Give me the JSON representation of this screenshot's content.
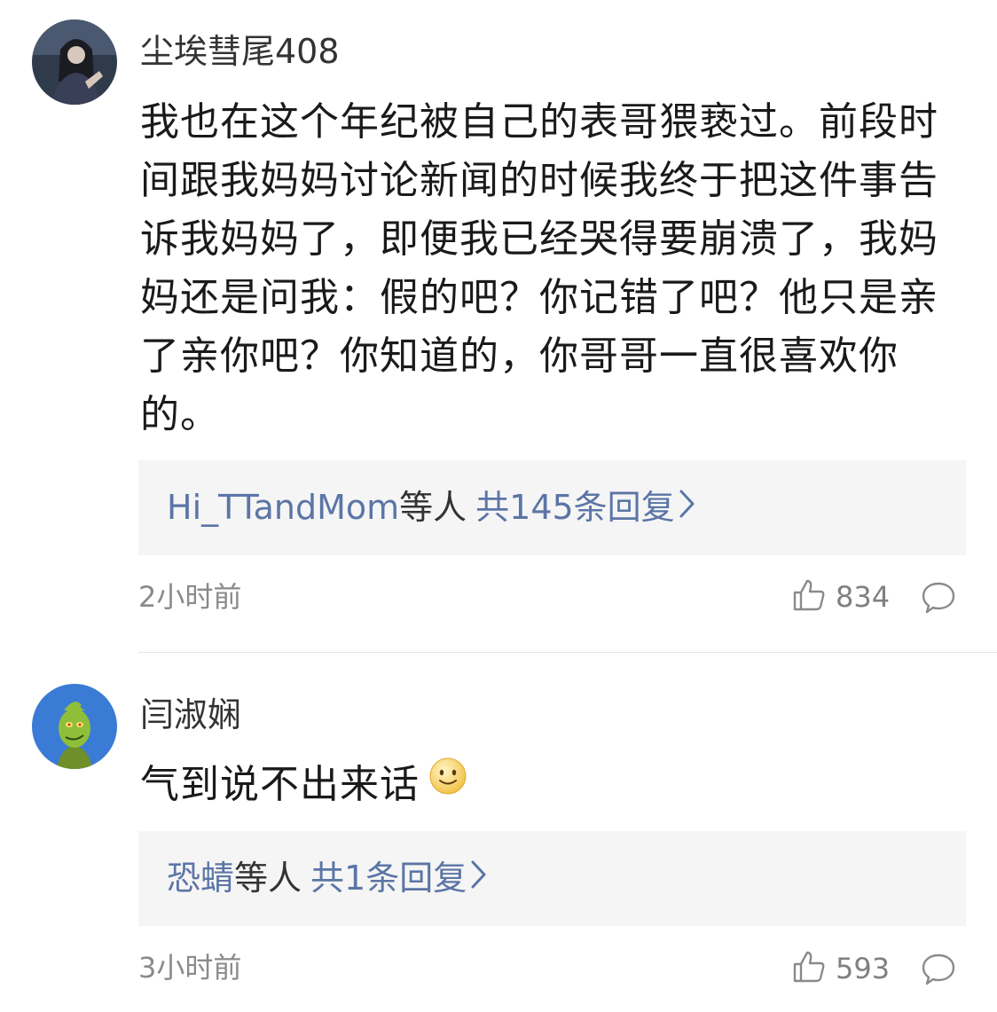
{
  "comments": [
    {
      "username": "尘埃彗尾408",
      "avatar_icon": "user-avatar-dark-portrait",
      "text": "我也在这个年纪被自己的表哥猥亵过。前段时间跟我妈妈讨论新闻的时候我终于把这件事告诉我妈妈了，即便我已经哭得要崩溃了，我妈妈还是问我：假的吧？你记错了吧？他只是亲了亲你吧？你知道的，你哥哥一直很喜欢你的。",
      "reply_preview": {
        "user": "Hi_TTandMom",
        "etc": "等人",
        "count_label": "共145条回复"
      },
      "time": "2小时前",
      "likes": "834"
    },
    {
      "username": "闫淑娴",
      "avatar_icon": "user-avatar-grinch-cartoon",
      "text": "气到说不出来话",
      "emoji": "smile-emoji",
      "reply_preview": {
        "user": "恐蜻",
        "etc": "等人",
        "count_label": "共1条回复"
      },
      "time": "3小时前",
      "likes": "593"
    }
  ],
  "icons": {
    "like": "thumbs-up-icon",
    "reply": "speech-bubble-icon",
    "chevron": "chevron-right-icon"
  },
  "colors": {
    "link": "#5b75a6",
    "reply_bg": "#f5f5f5",
    "meta": "#8a8a8a"
  }
}
